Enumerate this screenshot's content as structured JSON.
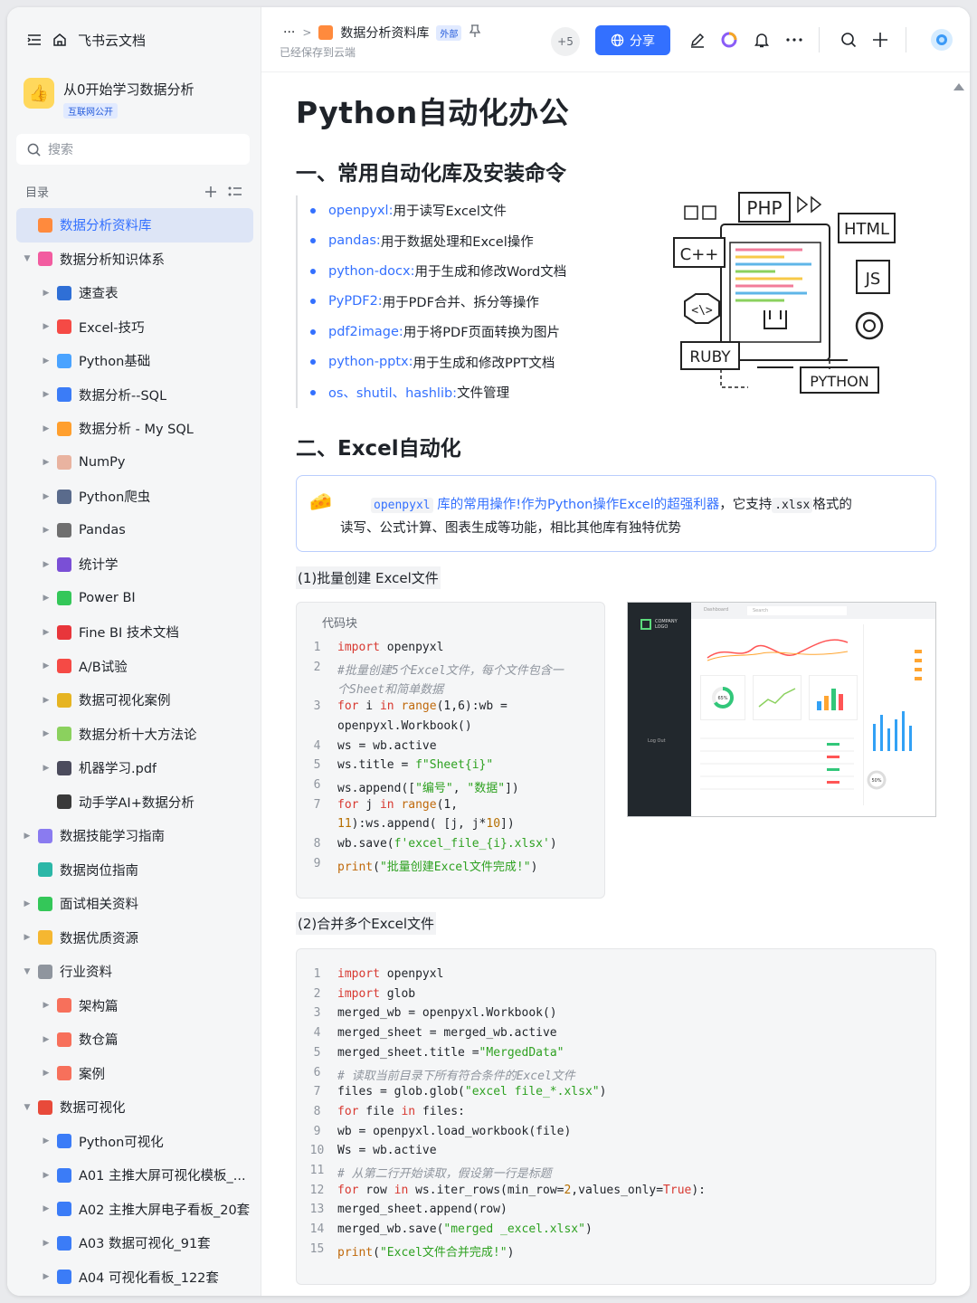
{
  "sidebar": {
    "home_label": "飞书云文档",
    "kb_title": "从0开始学习数据分析",
    "kb_badge": "互联网公开",
    "search_placeholder": "搜索",
    "toc_label": "目录",
    "items": [
      {
        "label": "数据分析资料库",
        "level": 0,
        "arrow": "",
        "icon_color": "#ff8a3d",
        "selected": true
      },
      {
        "label": "数据分析知识体系",
        "level": 0,
        "arrow": "▼",
        "icon_color": "#f25ca0"
      },
      {
        "label": "速查表",
        "level": 1,
        "arrow": "▶",
        "icon_color": "#2f6fd6"
      },
      {
        "label": "Excel-技巧",
        "level": 1,
        "arrow": "▶",
        "icon_color": "#f54a45"
      },
      {
        "label": "Python基础",
        "level": 1,
        "arrow": "▶",
        "icon_color": "#4aa3ff"
      },
      {
        "label": "数据分析--SQL",
        "level": 1,
        "arrow": "▶",
        "icon_color": "#3b7cf7"
      },
      {
        "label": "数据分析 - My SQL",
        "level": 1,
        "arrow": "▶",
        "icon_color": "#ff9f2e"
      },
      {
        "label": "NumPy",
        "level": 1,
        "arrow": "▶",
        "icon_color": "#e9b3a0"
      },
      {
        "label": "Python爬虫",
        "level": 1,
        "arrow": "▶",
        "icon_color": "#5a6b8c"
      },
      {
        "label": "Pandas",
        "level": 1,
        "arrow": "▶",
        "icon_color": "#6f6f6f"
      },
      {
        "label": "统计学",
        "level": 1,
        "arrow": "▶",
        "icon_color": "#7a4fd6"
      },
      {
        "label": "Power BI",
        "level": 1,
        "arrow": "▶",
        "icon_color": "#34c759"
      },
      {
        "label": "Fine BI 技术文档",
        "level": 1,
        "arrow": "▶",
        "icon_color": "#e8363b"
      },
      {
        "label": "A/B试验",
        "level": 1,
        "arrow": "▶",
        "icon_color": "#f54a45"
      },
      {
        "label": "数据可视化案例",
        "level": 1,
        "arrow": "▶",
        "icon_color": "#e6b422"
      },
      {
        "label": "数据分析十大方法论",
        "level": 1,
        "arrow": "▶",
        "icon_color": "#8bd15e"
      },
      {
        "label": "机器学习.pdf",
        "level": 1,
        "arrow": "▶",
        "icon_color": "#4b4b5c"
      },
      {
        "label": "动手学AI+数据分析",
        "level": 1,
        "arrow": "",
        "icon_color": "#3a3a3a"
      },
      {
        "label": "数据技能学习指南",
        "level": 0,
        "arrow": "▶",
        "icon_color": "#8a7bf0"
      },
      {
        "label": "数据岗位指南",
        "level": 0,
        "arrow": "",
        "icon_color": "#2bb7a7"
      },
      {
        "label": "面试相关资料",
        "level": 0,
        "arrow": "▶",
        "icon_color": "#34c759"
      },
      {
        "label": "数据优质资源",
        "level": 0,
        "arrow": "▶",
        "icon_color": "#f5b731"
      },
      {
        "label": "行业资料",
        "level": 0,
        "arrow": "▼",
        "icon_color": "#8f959e"
      },
      {
        "label": "架构篇",
        "level": 1,
        "arrow": "▶",
        "icon_color": "#f7705b"
      },
      {
        "label": "数仓篇",
        "level": 1,
        "arrow": "▶",
        "icon_color": "#f7705b"
      },
      {
        "label": "案例",
        "level": 1,
        "arrow": "▶",
        "icon_color": "#f7705b"
      },
      {
        "label": "数据可视化",
        "level": 0,
        "arrow": "▼",
        "icon_color": "#e84a3a"
      },
      {
        "label": "Python可视化",
        "level": 1,
        "arrow": "▶",
        "icon_color": "#3b7cf7"
      },
      {
        "label": "A01 主推大屏可视化模板_...",
        "level": 1,
        "arrow": "▶",
        "icon_color": "#3b7cf7"
      },
      {
        "label": "A02 主推大屏电子看板_20套",
        "level": 1,
        "arrow": "▶",
        "icon_color": "#3b7cf7"
      },
      {
        "label": "A03 数据可视化_91套",
        "level": 1,
        "arrow": "▶",
        "icon_color": "#3b7cf7"
      },
      {
        "label": "A04 可视化看板_122套",
        "level": 1,
        "arrow": "▶",
        "icon_color": "#3b7cf7"
      }
    ]
  },
  "header": {
    "more": "···",
    "doc_name": "数据分析资料库",
    "external_badge": "外部",
    "saved_text": "已经保存到云端",
    "collaborators": "+5",
    "share_label": "分享"
  },
  "doc": {
    "title": "Python自动化办公",
    "h2_1": "一、常用自动化库及安装命令",
    "libs": [
      {
        "key": "openpyxl:",
        "desc": " 用于读写Excel文件"
      },
      {
        "key": "pandas:",
        "desc": " 用于数据处理和Excel操作"
      },
      {
        "key": "python-docx:",
        "desc": " 用于生成和修改Word文档"
      },
      {
        "key": "PyPDF2:",
        "desc": " 用于PDF合并、拆分等操作"
      },
      {
        "key": "pdf2image:",
        "desc": " 用于将PDF页面转换为图片"
      },
      {
        "key": "python-pptx:",
        "desc": "用于生成和修改PPT文档"
      },
      {
        "key": "os、shutil、hashlib:",
        "desc": " 文件管理"
      }
    ],
    "illustration_labels": {
      "php": "PHP",
      "html": "HTML",
      "cpp": "C++",
      "js": "JS",
      "ruby": "RUBY",
      "python": "PYTHON"
    },
    "h2_2": "二、Excel自动化",
    "callout": {
      "code": "openpyxl",
      "link": " 库的常用操作!作为Python操作Excel的超强利器",
      "mid": "，它支持",
      "code2": ".xlsx",
      "tail": "格式的",
      "line2": "读写、公式计算、图表生成等功能，相比其他库有独特优势"
    },
    "sub1": "(1)批量创建 Excel文件",
    "code_label": "代码块",
    "sub2": "(2)合并多个Excel文件",
    "dashboard": {
      "brand": "COMPANY LOGO",
      "tab": "Dashboard",
      "search": "Search",
      "donut1": "65%",
      "donut2": "50%",
      "logout": "Log Out"
    }
  },
  "code1": [
    {
      "n": "1",
      "parts": [
        [
          "kw",
          "import"
        ],
        [
          "t",
          " openpyxl"
        ]
      ]
    },
    {
      "n": "2",
      "parts": [
        [
          "cm",
          "#批量创建5个Excel文件，每个文件包含一"
        ]
      ]
    },
    {
      "n": "",
      "parts": [
        [
          "cm",
          "个Sheet和简单数据"
        ]
      ]
    },
    {
      "n": "3",
      "parts": [
        [
          "kw",
          "for"
        ],
        [
          "t",
          " i "
        ],
        [
          "kw",
          "in"
        ],
        [
          "t",
          " "
        ],
        [
          "fn",
          "range"
        ],
        [
          "t",
          "(1,6):wb ="
        ]
      ]
    },
    {
      "n": "",
      "parts": [
        [
          "t",
          "openpyxl.Workbook()"
        ]
      ]
    },
    {
      "n": "4",
      "parts": [
        [
          "t",
          "ws = wb.active"
        ]
      ]
    },
    {
      "n": "5",
      "parts": [
        [
          "t",
          "ws.title = "
        ],
        [
          "st",
          "f\"Sheet{i}\""
        ]
      ]
    },
    {
      "n": "6",
      "parts": [
        [
          "t",
          "ws.append(["
        ],
        [
          "st",
          "\"编号\""
        ],
        [
          "t",
          ", "
        ],
        [
          "st",
          "\"数据\""
        ],
        [
          "t",
          "])"
        ]
      ]
    },
    {
      "n": "7",
      "parts": [
        [
          "kw",
          "for"
        ],
        [
          "t",
          " j "
        ],
        [
          "kw",
          "in"
        ],
        [
          "t",
          " "
        ],
        [
          "fn",
          "range"
        ],
        [
          "t",
          "(1,"
        ]
      ]
    },
    {
      "n": "",
      "parts": [
        [
          "nb",
          "11"
        ],
        [
          "t",
          "):ws.append( [j, j*"
        ],
        [
          "nb",
          "10"
        ],
        [
          "t",
          "])"
        ]
      ]
    },
    {
      "n": "8",
      "parts": [
        [
          "t",
          "wb.save("
        ],
        [
          "st",
          "f'excel_file_{i}.xlsx'"
        ],
        [
          "t",
          ")"
        ]
      ]
    },
    {
      "n": "9",
      "parts": [
        [
          "fn",
          "print"
        ],
        [
          "t",
          "("
        ],
        [
          "st",
          "\"批量创建Excel文件完成!\""
        ],
        [
          "t",
          ")"
        ]
      ]
    }
  ],
  "code2": [
    {
      "n": "1",
      "parts": [
        [
          "kw",
          "import"
        ],
        [
          "t",
          " openpyxl"
        ]
      ]
    },
    {
      "n": "2",
      "parts": [
        [
          "kw",
          "import"
        ],
        [
          "t",
          " glob"
        ]
      ]
    },
    {
      "n": "3",
      "parts": [
        [
          "t",
          "merged_wb = openpyxl.Workbook()"
        ]
      ]
    },
    {
      "n": "4",
      "parts": [
        [
          "t",
          "merged_sheet = merged_wb.active"
        ]
      ]
    },
    {
      "n": "5",
      "parts": [
        [
          "t",
          "merged_sheet.title ="
        ],
        [
          "st",
          "\"MergedData\""
        ]
      ]
    },
    {
      "n": "6",
      "parts": [
        [
          "cm",
          "# 读取当前目录下所有符合条件的Excel文件"
        ]
      ]
    },
    {
      "n": "7",
      "parts": [
        [
          "t",
          "files = glob.glob("
        ],
        [
          "st",
          "\"excel file_*.xlsx\""
        ],
        [
          "t",
          ")"
        ]
      ]
    },
    {
      "n": "8",
      "parts": [
        [
          "kw",
          "for"
        ],
        [
          "t",
          " file "
        ],
        [
          "kw",
          "in"
        ],
        [
          "t",
          " files:"
        ]
      ]
    },
    {
      "n": "9",
      "parts": [
        [
          "t",
          "wb = openpyxl.load_workbook(file)"
        ]
      ]
    },
    {
      "n": "10",
      "parts": [
        [
          "t",
          "Ws = wb.active"
        ]
      ]
    },
    {
      "n": "11",
      "parts": [
        [
          "cm",
          "# 从第二行开始读取，假设第一行是标题"
        ]
      ]
    },
    {
      "n": "12",
      "parts": [
        [
          "kw",
          "for"
        ],
        [
          "t",
          " row "
        ],
        [
          "kw",
          "in"
        ],
        [
          "t",
          " ws.iter_rows(min_row="
        ],
        [
          "nb",
          "2"
        ],
        [
          "t",
          ",values_only="
        ],
        [
          "kw",
          "True"
        ],
        [
          "t",
          "):"
        ]
      ]
    },
    {
      "n": "13",
      "parts": [
        [
          "t",
          "merged_sheet.append(row)"
        ]
      ]
    },
    {
      "n": "14",
      "parts": [
        [
          "t",
          "merged_wb.save("
        ],
        [
          "st",
          "\"merged _excel.xlsx\""
        ],
        [
          "t",
          ")"
        ]
      ]
    },
    {
      "n": "15",
      "parts": [
        [
          "fn",
          "print"
        ],
        [
          "t",
          "("
        ],
        [
          "st",
          "\"Excel文件合并完成!\""
        ],
        [
          "t",
          ")"
        ]
      ]
    }
  ]
}
